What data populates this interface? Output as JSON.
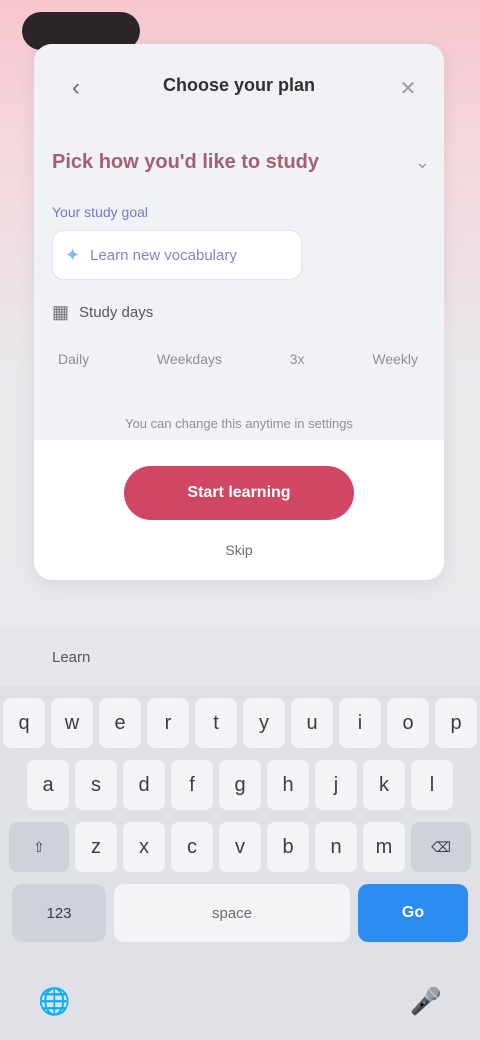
{
  "modal": {
    "back_icon": "‹",
    "title": "Choose your plan",
    "close_icon": "✕",
    "heading": "Pick how you'd like to study",
    "heading_chevron": "⌄",
    "field_label": "Your study goal",
    "input_icon": "✦",
    "input_value": "Learn new vocabulary",
    "section_icon": "▦",
    "section_label": "Study days",
    "options": [
      "Daily",
      "Weekdays",
      "3x",
      "Weekly"
    ],
    "footnote": "You can change this anytime in settings",
    "primary_button": "Start learning",
    "secondary_link": "Skip"
  },
  "keyboard": {
    "suggestion": "Learn",
    "row1": [
      "q",
      "w",
      "e",
      "r",
      "t",
      "y",
      "u",
      "i",
      "o",
      "p"
    ],
    "row2": [
      "a",
      "s",
      "d",
      "f",
      "g",
      "h",
      "j",
      "k",
      "l"
    ],
    "row3_shift": "⇧",
    "row3": [
      "z",
      "x",
      "c",
      "v",
      "b",
      "n",
      "m"
    ],
    "row3_delete": "⌫",
    "mode_key": "123",
    "space_key": "space",
    "go_key": "Go",
    "globe_icon": "🌐",
    "mic_icon": "🎤"
  },
  "colors": {
    "accent": "#cf4762",
    "keyboard_action": "#2d8cf0"
  }
}
